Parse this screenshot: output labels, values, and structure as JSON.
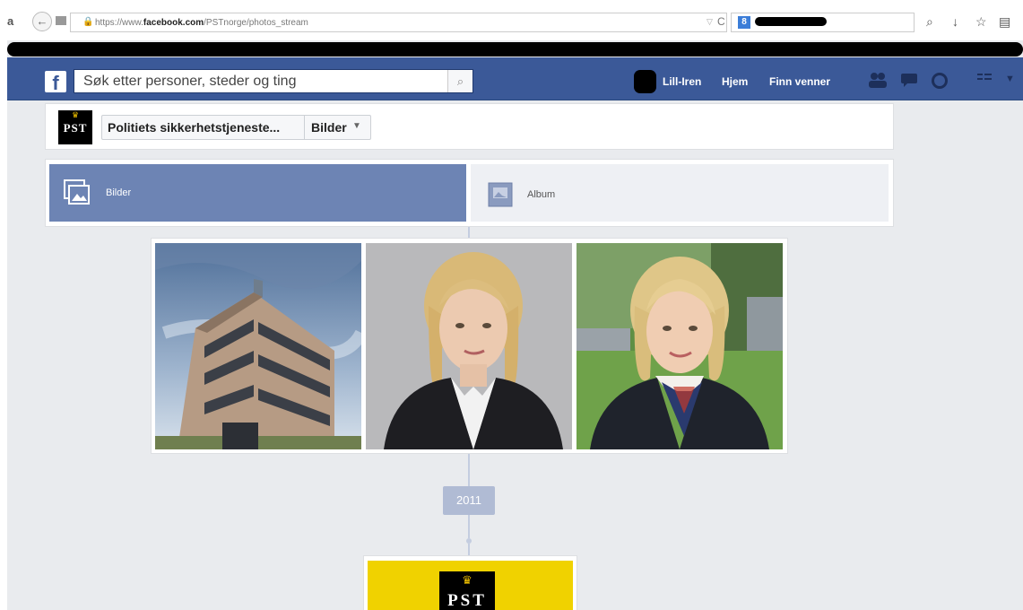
{
  "browser": {
    "amazon_icon": "a",
    "back_icon": "←",
    "url_prefix": "https://www.",
    "url_domain": "facebook.com",
    "url_path": "/PSTnorge/photos_stream",
    "reload_icon": "C",
    "search_engine_icon": "8",
    "search_icon": "⌕",
    "download_icon": "↓",
    "bookmark_icon": "☆",
    "library_icon": "▤"
  },
  "fb": {
    "logo": "f",
    "search_placeholder": "Søk etter personer, steder og ting",
    "search_icon": "⌕",
    "user_name": "Lill-Iren",
    "nav_home": "Hjem",
    "nav_find_friends": "Finn venner"
  },
  "page": {
    "logo_text": "PST",
    "name": "Politiets sikkerhetstjeneste...",
    "section": "Bilder",
    "section_arrow": "▼"
  },
  "tabs": [
    {
      "label": "Bilder",
      "icon": "photos-icon",
      "active": true
    },
    {
      "label": "Album",
      "icon": "album-icon",
      "active": false
    }
  ],
  "photos": [
    {
      "subject": "office-building"
    },
    {
      "subject": "woman-portrait-grey-background"
    },
    {
      "subject": "woman-portrait-outdoor"
    }
  ],
  "timeline": {
    "year": "2011"
  },
  "colors": {
    "fb_blue": "#3b5998",
    "tab_active": "#6d84b4",
    "page_bg": "#e9ebee",
    "pst_yellow": "#f0d200"
  }
}
